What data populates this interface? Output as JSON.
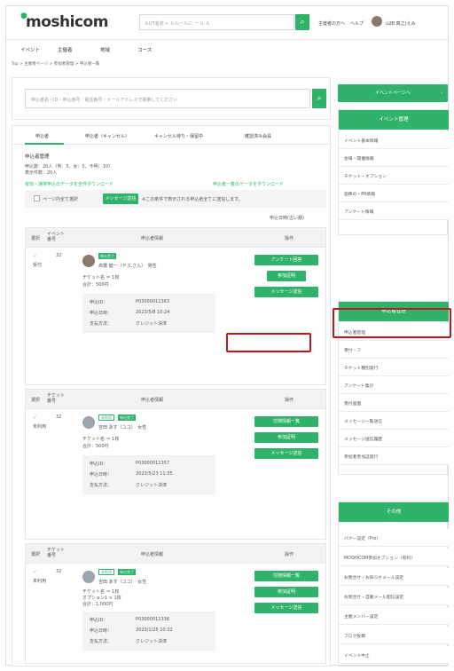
{
  "header": {
    "logo_text": "moshicom",
    "logo_sup": "●",
    "search_placeholder": "ルUT名前 ← ルルールに 一 ル ル",
    "search_icon": "search-icon",
    "links": [
      "主催者の方へ",
      "ヘルプ",
      "山田 真之(えみ"
    ]
  },
  "nav": {
    "items": [
      "イベント",
      "主催者",
      "地域",
      "コース"
    ]
  },
  "breadcrumb": "Top > 主催者ページ > 参加者管理 > 申込者一覧",
  "search": {
    "placeholder": "申込者名・ID・申込番号・電話番号・メールアドレスで検索してください"
  },
  "tabs": [
    "申込者",
    "申込者（キャンセル）",
    "キャンセル待ち・保留中",
    "確認済み会員"
  ],
  "main": {
    "section_title": "申込者管理",
    "summary_line1": "申込数：20人（男：5、女：5、不明：10）",
    "summary_line2": "表示件数：20人",
    "link_left": "有効・通常申込のデータを全件ダウンロード",
    "link_right": "申込者一覧のデータをダウンロード",
    "checkbox_label": "ページ内全て選択",
    "bulk_button": "メッセージ送信",
    "bulk_note": "※この条件で表示される申込者全てに送信します。",
    "sort_label": "申込日時(古い順)"
  },
  "table_headers": {
    "status": "選択",
    "ticket": "チケット番号",
    "applicant": "申込者情報",
    "action": "操作"
  },
  "entries": [
    {
      "status": "受付",
      "number": "32",
      "ticket_hd": "イベント番号",
      "badges": [
        "申込完了"
      ],
      "name": "高橋 健一（ヤス.さん）　男性",
      "ticket": "チケット名 ＝ 1枚",
      "price": "合計：500円",
      "info_labels": [
        "申込ID：",
        "申込日時：",
        "支払方法："
      ],
      "info_values": [
        "P03000011363",
        "2023/5/8 10:24",
        "クレジット決済"
      ],
      "buttons": [
        "アンケート回答",
        "参加証明",
        "メッセージ送信"
      ]
    },
    {
      "status": "未利用",
      "number": "32",
      "ticket_hd": "チケット番号",
      "badges": [
        "未利用",
        "申込完了"
      ],
      "name": "吉田 あす（ユコ）　女性",
      "ticket": "チケット名 ＝ 1枚",
      "price": "合計：500円",
      "info_labels": [
        "申込ID：",
        "申込日時：",
        "支払方法："
      ],
      "info_values": [
        "P03000011357",
        "2023/5/23 11:35",
        "クレジット決済"
      ],
      "buttons": [
        "付随情報一覧",
        "参加証明",
        "メッセージ送信"
      ]
    },
    {
      "status": "未利用",
      "number": "32",
      "ticket_hd": "チケット番号",
      "badges": [
        "未利用",
        "申込完了"
      ],
      "name": "吉田 あす（ユコ）　女性",
      "ticket": "チケット名 ＝ 1枚",
      "ticket2": "オプション1 × 1枚",
      "price": "合計：1,000円",
      "info_labels": [
        "申込ID：",
        "申込日時：",
        "支払方法："
      ],
      "info_values": [
        "P03000011336",
        "2023/1/25 10:32",
        "クレジット決済"
      ],
      "buttons": [
        "付随情報一覧",
        "参加証明",
        "メッセージ送信"
      ]
    }
  ],
  "sidebar": {
    "top_button": "イベントページへ",
    "event_header": "イベント管理",
    "event_items": [
      "イベント基本情報",
      "会場・開催情報",
      "チケット・オプション",
      "画像の・PR情報",
      "アンケート情報"
    ],
    "applicant_header": "申込者管理",
    "applicant_items": [
      "申込者管理",
      "受付・フ",
      "チケット種別発行",
      "アンケート集計",
      "受付画面",
      "メッセージ一覧送信",
      "メッセージ送信履歴",
      "参加者参加証発行"
    ],
    "other_header": "その他",
    "other_items": [
      "バナー設定（Pro）",
      "MOSHICOM参加オプション（有料）",
      "お問合せ・お知らせメール設定",
      "お問合せ・自動メール配信設定",
      "主催メンバー設定",
      "ブログ投稿",
      "イベント中止"
    ]
  },
  "colors": {
    "accent": "#2fb36a",
    "highlight": "#c0161e"
  }
}
